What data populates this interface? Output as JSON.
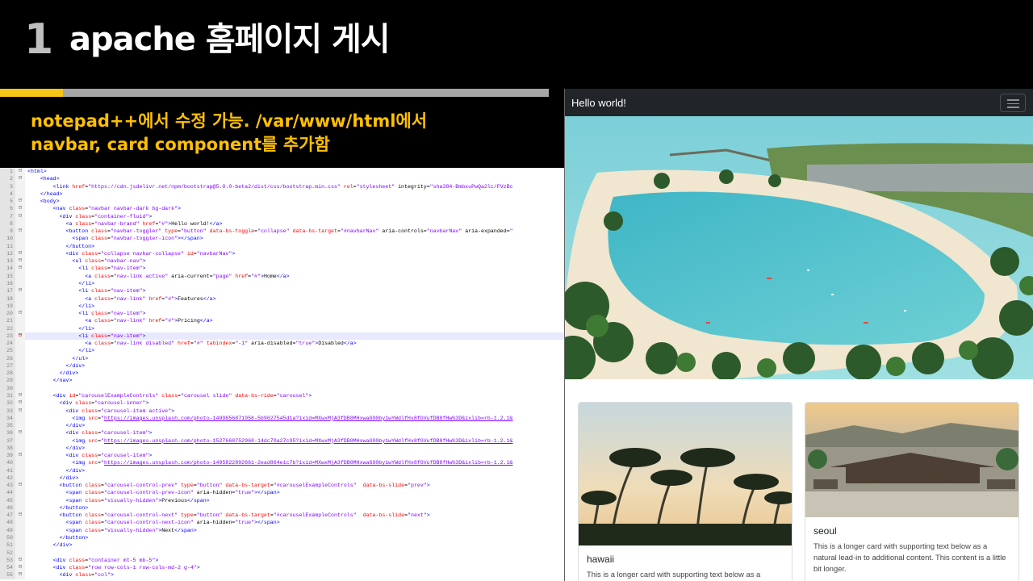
{
  "slide": {
    "number": "1",
    "title": "apache 홈페이지 게시",
    "subtitle_line1": "notepad++에서 수정 가능. /var/www/html에서",
    "subtitle_line2": "navbar, card component를 추가함"
  },
  "editor": {
    "lines": [
      {
        "n": "1",
        "f": "⊟",
        "html": "<span class='t'>&lt;html&gt;</span>"
      },
      {
        "n": "2",
        "f": "⊟",
        "html": "    <span class='t'>&lt;head&gt;</span>"
      },
      {
        "n": "3",
        "f": "",
        "html": "        <span class='t'>&lt;link</span> <span class='a'>href</span>=<span class='v'>\"https://cdn.jsdelivr.net/npm/bootstrap@5.0.0-beta2/dist/css/bootstrap.min.css\"</span> <span class='a'>rel</span>=<span class='v'>\"stylesheet\"</span> integrity=<span class='v'>\"sha384-BmbxuPwQa2lc/FVzBc</span>"
      },
      {
        "n": "4",
        "f": "",
        "html": "    <span class='t'>&lt;/head&gt;</span>"
      },
      {
        "n": "5",
        "f": "⊟",
        "html": "    <span class='t'>&lt;body&gt;</span>"
      },
      {
        "n": "6",
        "f": "⊟",
        "html": "        <span class='t'>&lt;nav</span> <span class='a'>class</span>=<span class='v'>\"navbar navbar-dark bg-dark\"</span><span class='t'>&gt;</span>"
      },
      {
        "n": "7",
        "f": "⊟",
        "html": "          <span class='t'>&lt;div</span> <span class='a'>class</span>=<span class='v'>\"container-fluid\"</span><span class='t'>&gt;</span>"
      },
      {
        "n": "8",
        "f": "",
        "html": "            <span class='t'>&lt;a</span> <span class='a'>class</span>=<span class='v'>\"navbar-brand\"</span> <span class='a'>href</span>=<span class='v'>\"#\"</span><span class='t'>&gt;</span>Hello world!<span class='t'>&lt;/a&gt;</span>"
      },
      {
        "n": "9",
        "f": "⊟",
        "html": "            <span class='t'>&lt;button</span> <span class='a'>class</span>=<span class='v'>\"navbar-toggler\"</span> <span class='a'>type</span>=<span class='v'>\"button\"</span> <span class='a'>data-bs-toggle</span>=<span class='v'>\"collapse\"</span> <span class='a'>data-bs-target</span>=<span class='v'>\"#navbarNav\"</span> aria-controls=<span class='v'>\"navbarNav\"</span> aria-expanded=<span class='v'>\"</span>"
      },
      {
        "n": "10",
        "f": "",
        "html": "              <span class='t'>&lt;span</span> <span class='a'>class</span>=<span class='v'>\"navbar-toggler-icon\"</span><span class='t'>&gt;&lt;/span&gt;</span>"
      },
      {
        "n": "11",
        "f": "",
        "html": "            <span class='t'>&lt;/button&gt;</span>"
      },
      {
        "n": "12",
        "f": "⊟",
        "html": "            <span class='t'>&lt;div</span> <span class='a'>class</span>=<span class='v'>\"collapse navbar-collapse\"</span> <span class='a'>id</span>=<span class='v'>\"navbarNav\"</span><span class='t'>&gt;</span>"
      },
      {
        "n": "13",
        "f": "⊟",
        "html": "              <span class='t'>&lt;ul</span> <span class='a'>class</span>=<span class='v'>\"navbar-nav\"</span><span class='t'>&gt;</span>"
      },
      {
        "n": "14",
        "f": "⊟",
        "html": "                <span class='t'>&lt;li</span> <span class='a'>class</span>=<span class='v'>\"nav-item\"</span><span class='t'>&gt;</span>"
      },
      {
        "n": "15",
        "f": "",
        "html": "                  <span class='t'>&lt;a</span> <span class='a'>class</span>=<span class='v'>\"nav-link active\"</span> aria-current=<span class='v'>\"page\"</span> <span class='a'>href</span>=<span class='v'>\"#\"</span><span class='t'>&gt;</span>Home<span class='t'>&lt;/a&gt;</span>"
      },
      {
        "n": "16",
        "f": "",
        "html": "                <span class='t'>&lt;/li&gt;</span>"
      },
      {
        "n": "17",
        "f": "⊟",
        "html": "                <span class='t'>&lt;li</span> <span class='a'>class</span>=<span class='v'>\"nav-item\"</span><span class='t'>&gt;</span>"
      },
      {
        "n": "18",
        "f": "",
        "html": "                  <span class='t'>&lt;a</span> <span class='a'>class</span>=<span class='v'>\"nav-link\"</span> <span class='a'>href</span>=<span class='v'>\"#\"</span><span class='t'>&gt;</span>Features<span class='t'>&lt;/a&gt;</span>"
      },
      {
        "n": "19",
        "f": "",
        "html": "                <span class='t'>&lt;/li&gt;</span>"
      },
      {
        "n": "20",
        "f": "⊟",
        "html": "                <span class='t'>&lt;li</span> <span class='a'>class</span>=<span class='v'>\"nav-item\"</span><span class='t'>&gt;</span>"
      },
      {
        "n": "21",
        "f": "",
        "html": "                  <span class='t'>&lt;a</span> <span class='a'>class</span>=<span class='v'>\"nav-link\"</span> <span class='a'>href</span>=<span class='v'>\"#\"</span><span class='t'>&gt;</span>Pricing<span class='t'>&lt;/a&gt;</span>"
      },
      {
        "n": "22",
        "f": "",
        "html": "                <span class='t'>&lt;/li&gt;</span>"
      },
      {
        "n": "23",
        "f": "⊟",
        "red": true,
        "hl": true,
        "html": "                <span class='t'>&lt;li</span> <span class='a'>class</span>=<span class='v'>\"nav-item\"</span><span class='t'>&gt;</span>"
      },
      {
        "n": "24",
        "f": "",
        "html": "                  <span class='t'>&lt;a</span> <span class='a'>class</span>=<span class='v'>\"nav-link disabled\"</span> <span class='a'>href</span>=<span class='v'>\"#\"</span> <span class='a'>tabindex</span>=<span class='v'>\"-1\"</span> aria-disabled=<span class='v'>\"true\"</span><span class='t'>&gt;</span>Disabled<span class='t'>&lt;/a&gt;</span>"
      },
      {
        "n": "25",
        "f": "",
        "html": "                <span class='t'>&lt;/li&gt;</span>"
      },
      {
        "n": "26",
        "f": "",
        "html": "              <span class='t'>&lt;/ul&gt;</span>"
      },
      {
        "n": "27",
        "f": "",
        "html": "            <span class='t'>&lt;/div&gt;</span>"
      },
      {
        "n": "28",
        "f": "",
        "html": "          <span class='t'>&lt;/div&gt;</span>"
      },
      {
        "n": "29",
        "f": "",
        "html": "        <span class='t'>&lt;/nav&gt;</span>"
      },
      {
        "n": "30",
        "f": "",
        "html": ""
      },
      {
        "n": "31",
        "f": "⊟",
        "html": "        <span class='t'>&lt;div</span> <span class='a'>id</span>=<span class='v'>\"carouselExampleControls\"</span> <span class='a'>class</span>=<span class='v'>\"carousel slide\"</span> <span class='a'>data-bs-ride</span>=<span class='v'>\"carousel\"</span><span class='t'>&gt;</span>"
      },
      {
        "n": "32",
        "f": "⊟",
        "html": "          <span class='t'>&lt;div</span> <span class='a'>class</span>=<span class='v'>\"carousel-inner\"</span><span class='t'>&gt;</span>"
      },
      {
        "n": "33",
        "f": "⊟",
        "html": "            <span class='t'>&lt;div</span> <span class='a'>class</span>=<span class='v'>\"carousel-item active\"</span><span class='t'>&gt;</span>"
      },
      {
        "n": "34",
        "f": "",
        "html": "              <span class='t'>&lt;img</span> <span class='a'>src</span>=<span class='v'>\"<u>https://images.unsplash.com/photo-1499856871958-5b9627545d1a?ixid=MXwxMjA3fDB8MHxwaG90by1wYWdlfHx8fGVufDB8fHw%3D&amp;ixlib=rb-1.2.1&amp;</u></span>"
      },
      {
        "n": "35",
        "f": "",
        "html": "            <span class='t'>&lt;/div&gt;</span>"
      },
      {
        "n": "36",
        "f": "⊟",
        "html": "            <span class='t'>&lt;div</span> <span class='a'>class</span>=<span class='v'>\"carousel-item\"</span><span class='t'>&gt;</span>"
      },
      {
        "n": "37",
        "f": "",
        "html": "              <span class='t'>&lt;img</span> <span class='a'>src</span>=<span class='v'>\"<u>https://images.unsplash.com/photo-1527668752968-14dc70a27c95?ixid=MXwxMjA3fDB8MHxwaG90by1wYWdlfHx8fGVufDB8fHw%3D&amp;ixlib=rb-1.2.1&amp;</u></span>"
      },
      {
        "n": "38",
        "f": "",
        "html": "            <span class='t'>&lt;/div&gt;</span>"
      },
      {
        "n": "39",
        "f": "⊟",
        "html": "            <span class='t'>&lt;div</span> <span class='a'>class</span>=<span class='v'>\"carousel-item\"</span><span class='t'>&gt;</span>"
      },
      {
        "n": "40",
        "f": "",
        "html": "              <span class='t'>&lt;img</span> <span class='a'>src</span>=<span class='v'>\"<u>https://images.unsplash.com/photo-1495822892661-2ead864e1c7b?ixid=MXwxMjA3fDB8MHxwaG90by1wYWdlfHx8fGVufDB8fHw%3D&amp;ixlib=rb-1.2.1&amp;</u></span>"
      },
      {
        "n": "41",
        "f": "",
        "html": "            <span class='t'>&lt;/div&gt;</span>"
      },
      {
        "n": "42",
        "f": "",
        "html": "          <span class='t'>&lt;/div&gt;</span>"
      },
      {
        "n": "43",
        "f": "⊟",
        "html": "          <span class='t'>&lt;button</span> <span class='a'>class</span>=<span class='v'>\"carousel-control-prev\"</span> <span class='a'>type</span>=<span class='v'>\"button\"</span> <span class='a'>data-bs-target</span>=<span class='v'>\"#carouselExampleControls\"</span>  <span class='a'>data-bs-slide</span>=<span class='v'>\"prev\"</span><span class='t'>&gt;</span>"
      },
      {
        "n": "44",
        "f": "",
        "html": "            <span class='t'>&lt;span</span> <span class='a'>class</span>=<span class='v'>\"carousel-control-prev-icon\"</span> aria-hidden=<span class='v'>\"true\"</span><span class='t'>&gt;&lt;/span&gt;</span>"
      },
      {
        "n": "45",
        "f": "",
        "html": "            <span class='t'>&lt;span</span> <span class='a'>class</span>=<span class='v'>\"visually-hidden\"</span><span class='t'>&gt;</span>Previous<span class='t'>&lt;/span&gt;</span>"
      },
      {
        "n": "46",
        "f": "",
        "html": "          <span class='t'>&lt;/button&gt;</span>"
      },
      {
        "n": "47",
        "f": "⊟",
        "html": "          <span class='t'>&lt;button</span> <span class='a'>class</span>=<span class='v'>\"carousel-control-next\"</span> <span class='a'>type</span>=<span class='v'>\"button\"</span> <span class='a'>data-bs-target</span>=<span class='v'>\"#carouselExampleControls\"</span>  <span class='a'>data-bs-slide</span>=<span class='v'>\"next\"</span><span class='t'>&gt;</span>"
      },
      {
        "n": "48",
        "f": "",
        "html": "            <span class='t'>&lt;span</span> <span class='a'>class</span>=<span class='v'>\"carousel-control-next-icon\"</span> aria-hidden=<span class='v'>\"true\"</span><span class='t'>&gt;&lt;/span&gt;</span>"
      },
      {
        "n": "49",
        "f": "",
        "html": "            <span class='t'>&lt;span</span> <span class='a'>class</span>=<span class='v'>\"visually-hidden\"</span><span class='t'>&gt;</span>Next<span class='t'>&lt;/span&gt;</span>"
      },
      {
        "n": "50",
        "f": "",
        "html": "          <span class='t'>&lt;/button&gt;</span>"
      },
      {
        "n": "51",
        "f": "",
        "html": "        <span class='t'>&lt;/div&gt;</span>"
      },
      {
        "n": "52",
        "f": "",
        "html": ""
      },
      {
        "n": "53",
        "f": "⊟",
        "html": "        <span class='t'>&lt;div</span> <span class='a'>class</span>=<span class='v'>\"container mt-5 mb-5\"</span><span class='t'>&gt;</span>"
      },
      {
        "n": "54",
        "f": "⊟",
        "html": "        <span class='t'>&lt;div</span> <span class='a'>class</span>=<span class='v'>\"row row-cols-1 row-cols-md-2 g-4\"</span><span class='t'>&gt;</span>"
      },
      {
        "n": "55",
        "f": "⊟",
        "html": "          <span class='t'>&lt;div</span> <span class='a'>class</span>=<span class='v'>\"col\"</span><span class='t'>&gt;</span>"
      }
    ]
  },
  "preview": {
    "brand": "Hello world!",
    "cards": [
      {
        "title": "hawaii",
        "text": "This is a longer card with supporting text below as a"
      },
      {
        "title": "seoul",
        "text": "This is a longer card with supporting text below as a natural lead-in to additional content. This content is a little bit longer."
      }
    ]
  },
  "colors": {
    "accent_yellow": "#f5c518",
    "subtitle": "#ffc000",
    "navbar": "#212529"
  }
}
